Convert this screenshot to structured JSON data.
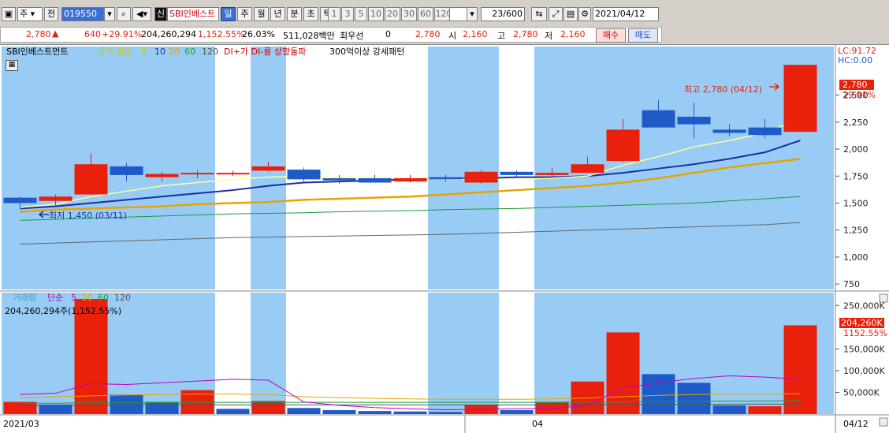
{
  "toolbar": {
    "type_value": "주",
    "type2_label": "전",
    "code_value": "019550",
    "stock_name": "SBI인베스트",
    "credit_badge": "신",
    "periods": [
      "일",
      "주",
      "월",
      "년",
      "분",
      "초",
      "틱"
    ],
    "selected_period": "일",
    "intervals": [
      "1",
      "3",
      "5",
      "10",
      "20",
      "30",
      "60",
      "120"
    ],
    "count_value": "23/600",
    "date_value": "2021/04/12"
  },
  "quote": {
    "price": "2,780",
    "change": "640",
    "change_pct": "+29.91%",
    "volume": "204,260,294",
    "volume_pct": "1,152.55%",
    "turnover_pct": "26.03%",
    "amount": "511,028백만",
    "broker": "최우선",
    "broker_value": "0",
    "best_price": "2,780",
    "open_label": "시",
    "open_value": "2,160",
    "high_label": "고",
    "high_value": "2,780",
    "low_label": "저",
    "low_value": "2,160",
    "buy_label": "매수",
    "sell_label": "매도"
  },
  "price_panel": {
    "legend_name": "SBI인베스트먼트",
    "legend_ma_label": "종가 단순",
    "legend_ma_periods": [
      "5",
      "10",
      "20",
      "60",
      "120"
    ],
    "legend_di": "DI+가 DI-를 상향돌파",
    "legend_pattern": "300억이상 강세패턴",
    "lc_label": "LC:91.72",
    "hc_label": "HC:0.00",
    "max_annotation": "최고 2,780 (04/12)",
    "min_annotation": "최저 1,450 (03/11)",
    "current_price_tag": "2,780",
    "current_pct": "29.91%"
  },
  "volume_panel": {
    "legend_name": "거래량",
    "legend_ma_label": "단순",
    "legend_ma_periods": [
      "5",
      "20",
      "60",
      "120"
    ],
    "total_label": "204,260,294주(1,152.55%)",
    "current_tag": "204,260K",
    "current_pct": "1152.55%"
  },
  "x_axis": {
    "left_label": "2021/03",
    "mid_label": "04",
    "right_label": "04/12"
  },
  "colors": {
    "up": "#e8200c",
    "down": "#1e5bc8",
    "bg_shade": "#99ccf5",
    "ma5": "#ffff99",
    "ma10": "#1a2fa0",
    "ma20": "#e8a300",
    "ma60": "#1a9c3a",
    "ma120": "#666666"
  },
  "chart_data": [
    {
      "type": "candlestick",
      "title": "SBI인베스트먼트",
      "ylim": [
        700,
        2950
      ],
      "y_ticks": [
        "2,500",
        "2,250",
        "2,000",
        "1,750",
        "1,500",
        "1,250",
        "1,000",
        "750"
      ],
      "candles": [
        {
          "o": 1550,
          "h": 1560,
          "l": 1450,
          "c": 1500
        },
        {
          "o": 1520,
          "h": 1580,
          "l": 1480,
          "c": 1560
        },
        {
          "o": 1580,
          "h": 1960,
          "l": 1570,
          "c": 1860
        },
        {
          "o": 1840,
          "h": 1870,
          "l": 1700,
          "c": 1760
        },
        {
          "o": 1740,
          "h": 1790,
          "l": 1700,
          "c": 1770
        },
        {
          "o": 1770,
          "h": 1800,
          "l": 1730,
          "c": 1780
        },
        {
          "o": 1770,
          "h": 1800,
          "l": 1750,
          "c": 1780
        },
        {
          "o": 1800,
          "h": 1880,
          "l": 1790,
          "c": 1840
        },
        {
          "o": 1810,
          "h": 1830,
          "l": 1690,
          "c": 1720
        },
        {
          "o": 1730,
          "h": 1760,
          "l": 1680,
          "c": 1710
        },
        {
          "o": 1730,
          "h": 1760,
          "l": 1700,
          "c": 1690
        },
        {
          "o": 1700,
          "h": 1760,
          "l": 1690,
          "c": 1730
        },
        {
          "o": 1740,
          "h": 1760,
          "l": 1700,
          "c": 1720
        },
        {
          "o": 1690,
          "h": 1810,
          "l": 1680,
          "c": 1790
        },
        {
          "o": 1790,
          "h": 1800,
          "l": 1740,
          "c": 1760
        },
        {
          "o": 1760,
          "h": 1830,
          "l": 1740,
          "c": 1780
        },
        {
          "o": 1780,
          "h": 1930,
          "l": 1780,
          "c": 1860
        },
        {
          "o": 1890,
          "h": 2280,
          "l": 1880,
          "c": 2180
        },
        {
          "o": 2360,
          "h": 2450,
          "l": 2200,
          "c": 2200
        },
        {
          "o": 2300,
          "h": 2430,
          "l": 2100,
          "c": 2230
        },
        {
          "o": 2180,
          "h": 2230,
          "l": 2120,
          "c": 2150
        },
        {
          "o": 2200,
          "h": 2280,
          "l": 2100,
          "c": 2130
        },
        {
          "o": 2160,
          "h": 2780,
          "l": 2160,
          "c": 2780
        }
      ],
      "ma": {
        "ma5": [
          1460,
          1490,
          1560,
          1610,
          1660,
          1690,
          1720,
          1740,
          1750,
          1740,
          1740,
          1730,
          1720,
          1720,
          1720,
          1730,
          1750,
          1850,
          1930,
          2020,
          2080,
          2150,
          2280
        ],
        "ma10": [
          1450,
          1470,
          1500,
          1530,
          1560,
          1590,
          1620,
          1660,
          1690,
          1700,
          1710,
          1720,
          1730,
          1730,
          1740,
          1740,
          1750,
          1780,
          1820,
          1860,
          1910,
          1970,
          2080
        ],
        "ma20": [
          1420,
          1440,
          1450,
          1460,
          1470,
          1490,
          1500,
          1510,
          1530,
          1540,
          1550,
          1560,
          1580,
          1600,
          1620,
          1640,
          1660,
          1690,
          1730,
          1780,
          1830,
          1870,
          1910
        ],
        "ma60": [
          1340,
          1350,
          1360,
          1370,
          1380,
          1390,
          1400,
          1405,
          1410,
          1420,
          1425,
          1430,
          1440,
          1445,
          1450,
          1460,
          1470,
          1480,
          1490,
          1500,
          1520,
          1540,
          1560
        ],
        "ma120": [
          1120,
          1130,
          1140,
          1150,
          1160,
          1170,
          1180,
          1185,
          1190,
          1195,
          1200,
          1205,
          1210,
          1220,
          1230,
          1240,
          1250,
          1260,
          1270,
          1280,
          1290,
          1300,
          1320
        ]
      }
    },
    {
      "type": "bar",
      "title": "거래량",
      "ylim": [
        0,
        265000
      ],
      "y_ticks": [
        "250,000K",
        "150,000K",
        "100,000K",
        "50,000K"
      ],
      "values": [
        28000,
        22000,
        265000,
        45000,
        28000,
        55000,
        12000,
        30000,
        14000,
        9000,
        7000,
        6000,
        5000,
        22000,
        9000,
        28000,
        75000,
        188000,
        92000,
        72000,
        20000,
        18000,
        204260
      ],
      "directions": [
        "up",
        "down",
        "up",
        "down",
        "down",
        "up",
        "down",
        "up",
        "down",
        "down",
        "down",
        "down",
        "down",
        "up",
        "down",
        "up",
        "up",
        "up",
        "down",
        "down",
        "down",
        "up",
        "up"
      ],
      "ma": {
        "ma5": [
          45000,
          48000,
          70000,
          68000,
          72000,
          76000,
          80000,
          78000,
          28000,
          20000,
          15000,
          12000,
          10000,
          11000,
          12000,
          13000,
          20000,
          60000,
          72000,
          82000,
          88000,
          85000,
          80000
        ],
        "ma20": [
          38000,
          40000,
          42000,
          44000,
          45000,
          46000,
          46000,
          45000,
          40000,
          38000,
          36000,
          35000,
          34000,
          34000,
          34000,
          35000,
          37000,
          40000,
          43000,
          45000,
          46000,
          46000,
          47000
        ],
        "ma60": [
          25000,
          25000,
          26000,
          26000,
          26000,
          27000,
          27000,
          27000,
          27000,
          27000,
          27000,
          27000,
          27000,
          27000,
          27000,
          27000,
          28000,
          28000,
          29000,
          29000,
          30000,
          30000,
          31000
        ],
        "ma120": [
          20000,
          20000,
          20000,
          21000,
          21000,
          21000,
          21000,
          21000,
          21000,
          21000,
          21000,
          21000,
          21000,
          21000,
          21000,
          21000,
          22000,
          22000,
          22000,
          22000,
          23000,
          23000,
          23000
        ]
      }
    }
  ],
  "unshaded_days": [
    6,
    8,
    9,
    10,
    11,
    14
  ]
}
